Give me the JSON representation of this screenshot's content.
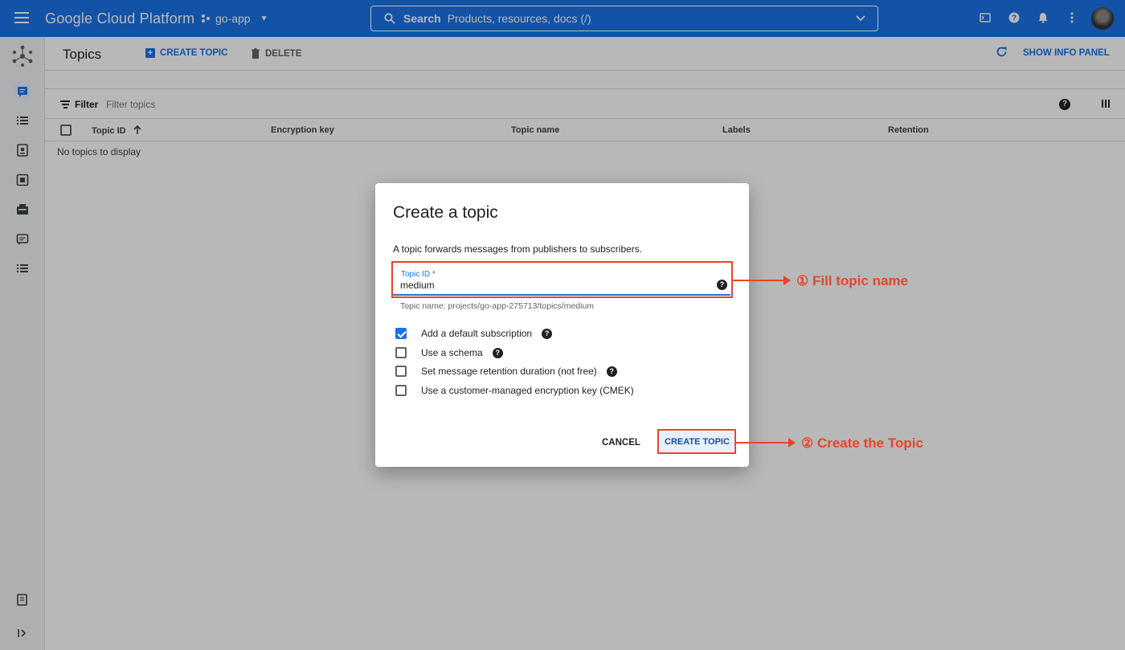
{
  "topbar": {
    "brand": "Google Cloud Platform",
    "project": "go-app",
    "search_label": "Search",
    "search_placeholder": "Products, resources, docs (/)",
    "icons": [
      "terminal-icon",
      "help-icon",
      "notifications-icon",
      "more-vert-icon",
      "avatar"
    ]
  },
  "leftnav": {
    "icons": [
      "pubsub-logo-icon",
      "topics-icon",
      "subscriptions-icon",
      "snapshots-icon",
      "schemas-icon",
      "lite-icon",
      "messages-icon",
      "list-icon",
      "release-notes-icon",
      "expand-icon"
    ]
  },
  "header": {
    "title": "Topics",
    "create_label": "CREATE TOPIC",
    "delete_label": "DELETE",
    "info_label": "SHOW INFO PANEL"
  },
  "filter": {
    "label": "Filter",
    "placeholder": "Filter topics"
  },
  "table": {
    "columns": [
      "Topic ID",
      "Encryption key",
      "Topic name",
      "Labels",
      "Retention"
    ],
    "empty": "No topics to display"
  },
  "dialog": {
    "title": "Create a topic",
    "description": "A topic forwards messages from publishers to subscribers.",
    "field_label": "Topic ID *",
    "field_value": "medium",
    "field_hint": "Topic name: projects/go-app-275713/topics/medium",
    "options": [
      {
        "label": "Add a default subscription",
        "checked": true,
        "help": true
      },
      {
        "label": "Use a schema",
        "checked": false,
        "help": true
      },
      {
        "label": "Set message retention duration (not free)",
        "checked": false,
        "help": true
      },
      {
        "label": "Use a customer-managed encryption key (CMEK)",
        "checked": false,
        "help": false
      }
    ],
    "cancel_label": "CANCEL",
    "create_label": "CREATE TOPIC"
  },
  "annotations": {
    "step1": "① Fill topic name",
    "step2": "② Create the Topic",
    "color": "#e8452c"
  },
  "colors": {
    "topbar": "#1a73e8",
    "primary": "#1a73e8"
  }
}
